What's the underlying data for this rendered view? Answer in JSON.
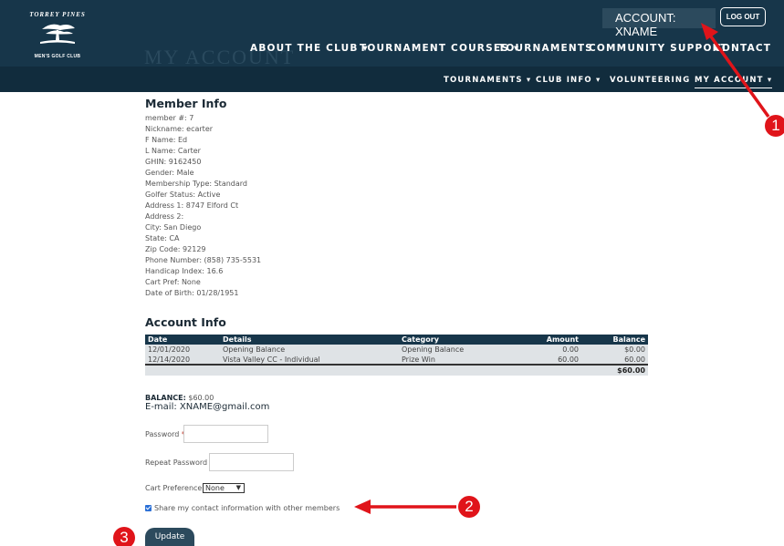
{
  "logo": {
    "top_text": "TORREY PINES",
    "bottom_text": "MEN'S GOLF CLUB"
  },
  "ghost_title": "MY ACCOUNT",
  "account": {
    "label": "ACCOUNT: XNAME",
    "logout": "LOG OUT"
  },
  "nav_main": [
    "ABOUT THE CLUB ▾",
    "TOURNAMENT COURSES ▾",
    "TOURNAMENTS",
    "COMMUNITY SUPPORT",
    "CONTACT"
  ],
  "nav_sub": [
    "TOURNAMENTS ▾",
    "CLUB INFO ▾",
    "VOLUNTEERING",
    "MY ACCOUNT ▾"
  ],
  "member_info": {
    "heading": "Member Info",
    "lines": [
      "member #: 7",
      "Nickname: ecarter",
      "F Name: Ed",
      "L Name: Carter",
      "GHIN: 9162450",
      "Gender: Male",
      "Membership Type: Standard",
      "Golfer Status: Active",
      "Address 1: 8747 Elford Ct",
      "Address 2:",
      "City: San Diego",
      "State: CA",
      "Zip Code: 92129",
      "Phone Number: (858) 735-5531",
      "Handicap Index: 16.6",
      "Cart Pref: None",
      "Date of Birth: 01/28/1951"
    ]
  },
  "account_info": {
    "heading": "Account Info",
    "columns": [
      "Date",
      "Details",
      "Category",
      "Amount",
      "Balance"
    ],
    "rows": [
      [
        "12/01/2020",
        "Opening Balance",
        "Opening Balance",
        "0.00",
        "$0.00"
      ],
      [
        "12/14/2020",
        "Vista Valley CC - Individual",
        "Prize Win",
        "60.00",
        "60.00"
      ]
    ],
    "total": "$60.00"
  },
  "balance": {
    "label": "BALANCE:",
    "value": "$60.00"
  },
  "email": "E-mail: XNAME@gmail.com",
  "form": {
    "password_label": "Password",
    "repeat_label": "Repeat Password",
    "required_mark": "*",
    "cart_label": "Cart Preference",
    "cart_value": "None",
    "share_label": "Share my contact information with other members",
    "share_checked": true,
    "update": "Update"
  },
  "annotations": {
    "badges": [
      "1",
      "2",
      "3"
    ],
    "color": "#e0141a"
  },
  "colors": {
    "header": "#17364a",
    "button": "#2c4a5d"
  }
}
